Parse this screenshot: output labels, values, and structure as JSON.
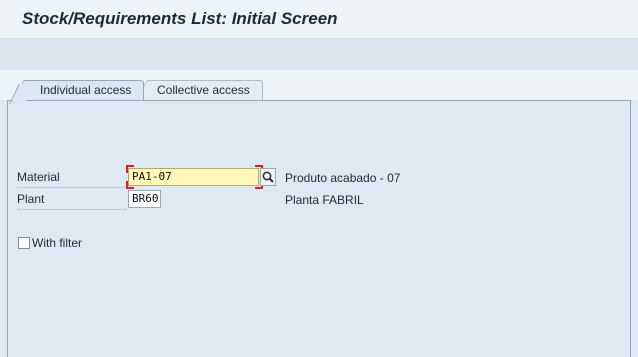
{
  "title": "Stock/Requirements List: Initial Screen",
  "tabs": [
    {
      "label": "Individual access",
      "active": true
    },
    {
      "label": "Collective access",
      "active": false
    }
  ],
  "form": {
    "material": {
      "label": "Material",
      "value": "PA1-07",
      "description": "Produto acabado - 07",
      "required": true
    },
    "plant": {
      "label": "Plant",
      "value": "BR60",
      "description": "Planta FABRIL"
    },
    "with_filter": {
      "label": "With filter",
      "checked": false
    }
  },
  "icons": {
    "value_help": "search-icon"
  },
  "colors": {
    "required_marker": "#d81e1e",
    "focused_field_bg": "#fff8b8",
    "background": "#dfe9f2"
  }
}
